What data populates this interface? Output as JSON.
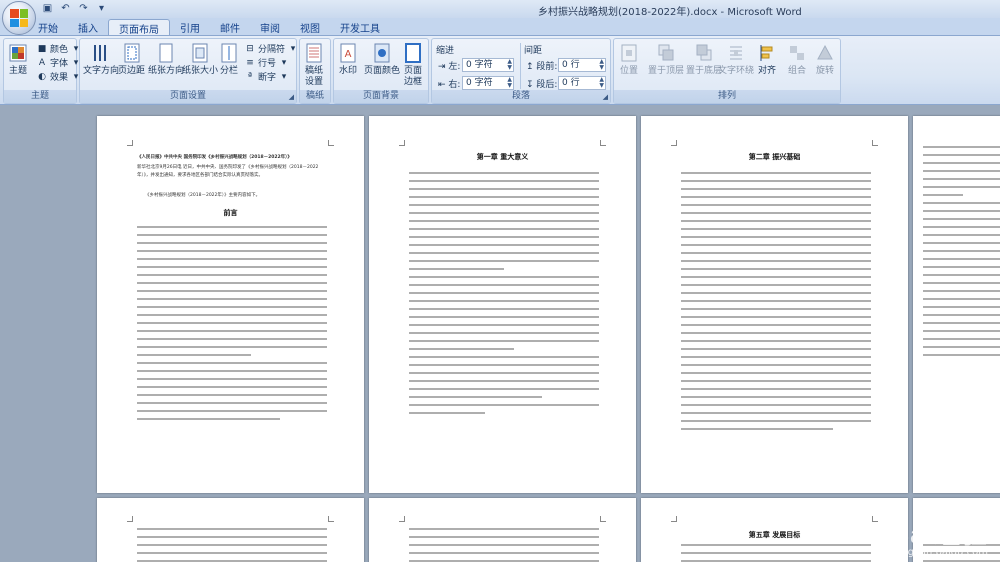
{
  "window": {
    "title": "乡村振兴战略规划(2018-2022年).docx - Microsoft Word"
  },
  "tabs": [
    "开始",
    "插入",
    "页面布局",
    "引用",
    "邮件",
    "审阅",
    "视图",
    "开发工具"
  ],
  "active_tab": "页面布局",
  "ribbon": {
    "theme_group": {
      "label": "主题",
      "theme_button": "主题",
      "colors": "颜色",
      "fonts": "字体",
      "effects": "效果"
    },
    "page_setup_group": {
      "label": "页面设置",
      "text_direction": "文字方向",
      "margins": "页边距",
      "orientation": "纸张方向",
      "size": "纸张大小",
      "columns": "分栏",
      "breaks": "分隔符",
      "line_numbers": "行号",
      "hyphenation": "断字"
    },
    "manuscript_group": {
      "label": "稿纸",
      "manuscript_settings": "稿纸设置"
    },
    "page_background_group": {
      "label": "页面背景",
      "watermark": "水印",
      "page_color": "页面颜色",
      "page_borders": "页面边框"
    },
    "paragraph_group": {
      "label": "段落",
      "indent_title": "缩进",
      "indent_left_label": "左:",
      "indent_left_value": "0 字符",
      "indent_right_label": "右:",
      "indent_right_value": "0 字符",
      "spacing_title": "间距",
      "spacing_before_label": "段前:",
      "spacing_before_value": "0 行",
      "spacing_after_label": "段后:",
      "spacing_after_value": "0 行"
    },
    "arrange_group": {
      "label": "排列",
      "position": "位置",
      "bring_front": "置于顶层",
      "send_back": "置于底层",
      "text_wrap": "文字环绕",
      "align": "对齐",
      "group": "组合",
      "rotate": "旋转"
    }
  },
  "pages": [
    {
      "heading": "前言",
      "top_lines": [
        "《人民日报》中共中央 国务院印发《乡村振兴战略规划（2018－2022年）》",
        "新华社北京9月26日电 近日，中共中央、国务院印发了《乡村振兴战略规划（2018－2022年）》，并发出通知，要求各地区各部门结合实际认真贯彻落实。",
        "《乡村振兴战略规划（2018－2022年）》主要内容如下。"
      ]
    },
    {
      "heading": "第一章 重大意义"
    },
    {
      "heading": "第二章 振兴基础"
    },
    {
      "heading": ""
    },
    {
      "heading": ""
    },
    {
      "heading": "第五章 发展目标"
    }
  ],
  "watermark": {
    "brand": "Bai经验",
    "url": "jingyan.baidu.com"
  },
  "colors": {
    "ribbon_bg": "#dbe6f4",
    "tab_text": "#15428b",
    "workspace": "#9aa9bc"
  }
}
